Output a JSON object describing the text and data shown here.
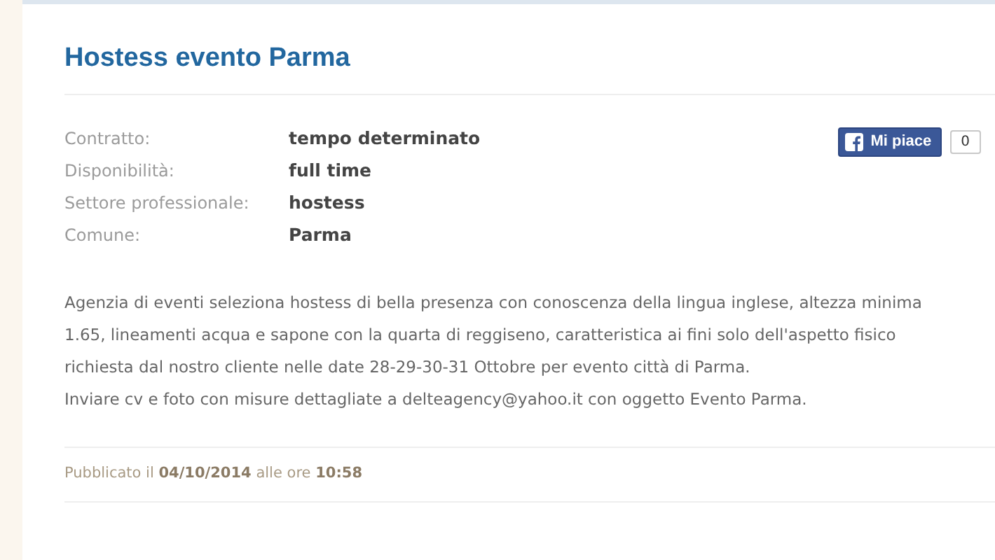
{
  "title": "Hostess evento Parma",
  "details": [
    {
      "label": "Contratto:",
      "value": "tempo determinato"
    },
    {
      "label": "Disponibilità:",
      "value": "full time"
    },
    {
      "label": "Settore professionale:",
      "value": "hostess"
    },
    {
      "label": "Comune:",
      "value": "Parma"
    }
  ],
  "like_button": {
    "label": "Mi piace",
    "count": "0"
  },
  "description": [
    "Agenzia di eventi seleziona hostess di bella presenza con conoscenza della lingua inglese, altezza minima 1.65, lineamenti acqua e sapone con la quarta di reggiseno, caratteristica ai fini solo dell'aspetto fisico richiesta dal nostro cliente nelle date 28-29-30-31 Ottobre per evento città di Parma.",
    "Inviare cv e foto con misure dettagliate a delteagency@yahoo.it con oggetto Evento Parma."
  ],
  "published": "Pubblicato il **04/10/2014** alle ore **10:58**"
}
